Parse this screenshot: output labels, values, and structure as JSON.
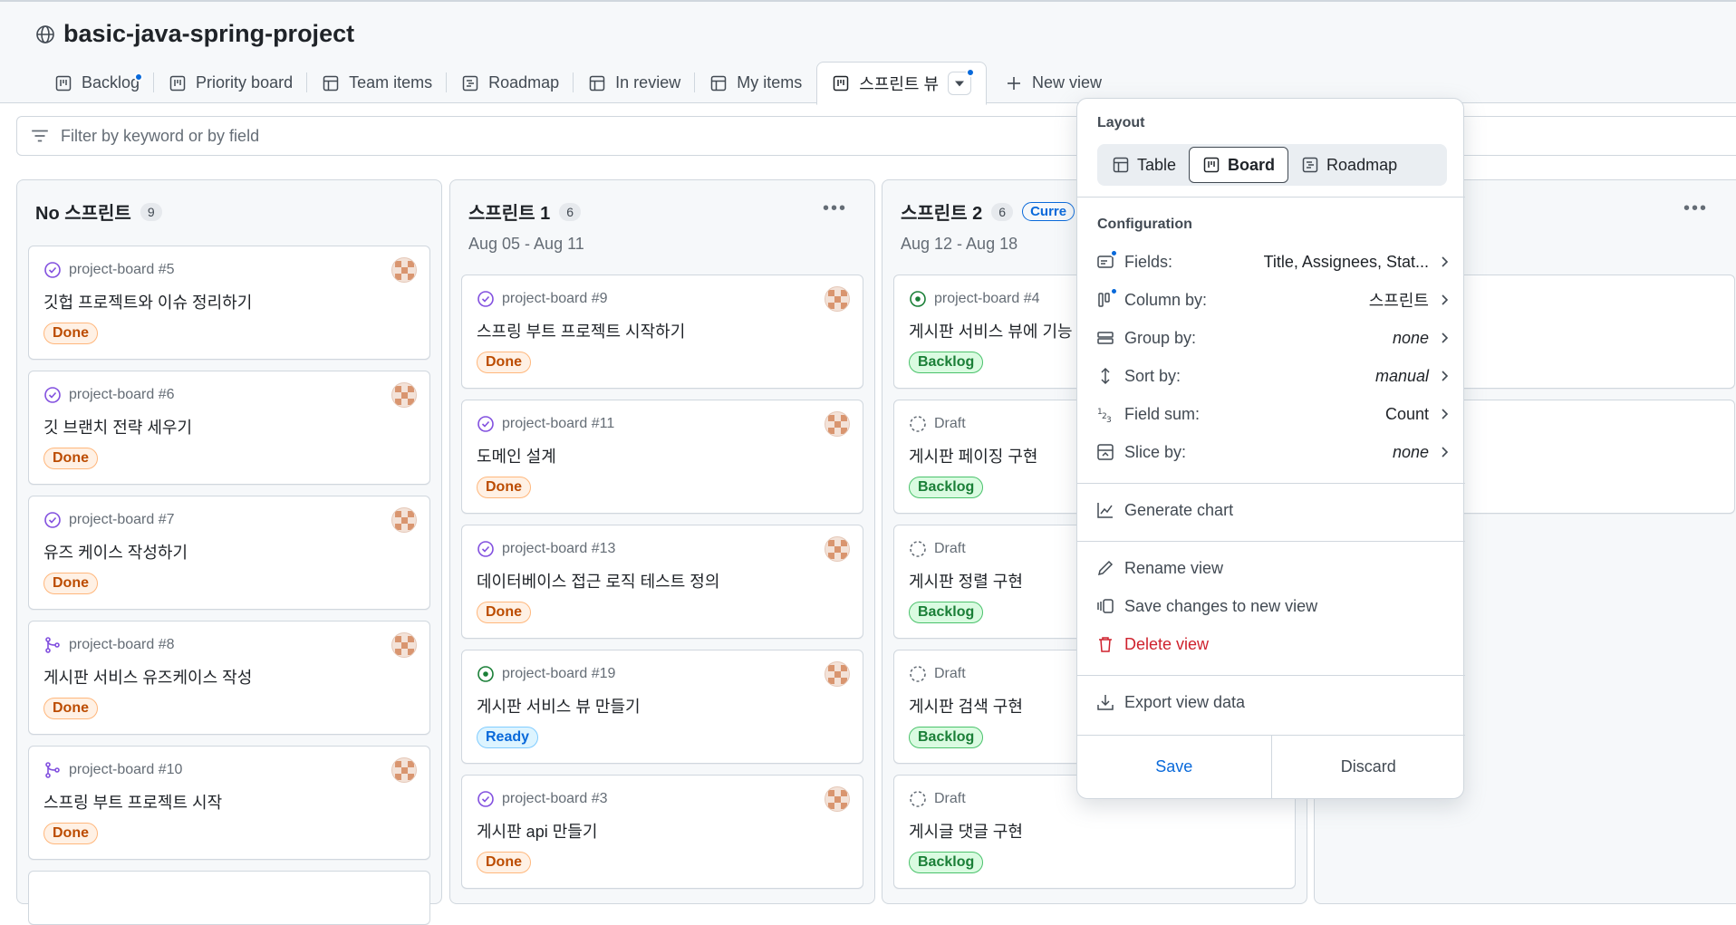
{
  "project": {
    "title": "basic-java-spring-project"
  },
  "tabs": [
    {
      "label": "Backlog",
      "icon": "board-icon"
    },
    {
      "label": "Priority board",
      "icon": "board-icon"
    },
    {
      "label": "Team items",
      "icon": "table-icon"
    },
    {
      "label": "Roadmap",
      "icon": "roadmap-icon"
    },
    {
      "label": "In review",
      "icon": "table-icon"
    },
    {
      "label": "My items",
      "icon": "table-icon"
    },
    {
      "label": "스프린트 뷰",
      "icon": "board-icon"
    }
  ],
  "new_view_label": "New view",
  "filter": {
    "placeholder": "Filter by keyword or by field"
  },
  "columns": [
    {
      "title": "No 스프린트",
      "count": "9",
      "dates": "",
      "cards": [
        {
          "ref": "project-board #5",
          "title": "깃헙 프로젝트와 이슈 정리하기",
          "status": "Done"
        },
        {
          "ref": "project-board #6",
          "title": "깃 브랜치 전략 세우기",
          "status": "Done"
        },
        {
          "ref": "project-board #7",
          "title": "유즈 케이스 작성하기",
          "status": "Done"
        },
        {
          "ref": "project-board #8",
          "title": "게시판 서비스 유즈케이스 작성",
          "status": "Done"
        },
        {
          "ref": "project-board #10",
          "title": "스프링 부트 프로젝트 시작",
          "status": "Done"
        }
      ]
    },
    {
      "title": "스프린트 1",
      "count": "6",
      "dates": "Aug 05 - Aug 11",
      "cards": [
        {
          "ref": "project-board #9",
          "title": "스프링 부트 프로젝트 시작하기",
          "status": "Done"
        },
        {
          "ref": "project-board #11",
          "title": "도메인 설계",
          "status": "Done"
        },
        {
          "ref": "project-board #13",
          "title": "데이터베이스 접근 로직 테스트 정의",
          "status": "Done"
        },
        {
          "ref": "project-board #19",
          "title": "게시판 서비스 뷰 만들기",
          "status": "Ready"
        },
        {
          "ref": "project-board #3",
          "title": "게시판 api 만들기",
          "status": "Done"
        }
      ]
    },
    {
      "title": "스프린트 2",
      "count": "6",
      "dates": "Aug 12 - Aug 18",
      "badge": "Curre",
      "cards": [
        {
          "ref": "project-board #4",
          "title": "게시판 서비스 뷰에 기능 구",
          "status": "Backlog"
        },
        {
          "ref": "Draft",
          "title": "게시판 페이징 구현",
          "status": "Backlog"
        },
        {
          "ref": "Draft",
          "title": "게시판 정렬 구현",
          "status": "Backlog"
        },
        {
          "ref": "Draft",
          "title": "게시판 검색 구현",
          "status": "Backlog"
        },
        {
          "ref": "Draft",
          "title": "게시글 댓글 구현",
          "status": "Backlog"
        }
      ]
    }
  ],
  "menu": {
    "layout_label": "Layout",
    "layouts": [
      "Table",
      "Board",
      "Roadmap"
    ],
    "config_label": "Configuration",
    "config": [
      {
        "label": "Fields:",
        "value": "Title, Assignees, Stat..."
      },
      {
        "label": "Column by:",
        "value": "스프린트"
      },
      {
        "label": "Group by:",
        "value": "none"
      },
      {
        "label": "Sort by:",
        "value": "manual"
      },
      {
        "label": "Field sum:",
        "value": "Count"
      },
      {
        "label": "Slice by:",
        "value": "none"
      }
    ],
    "generate_chart": "Generate chart",
    "rename": "Rename view",
    "save_new": "Save changes to new view",
    "delete": "Delete view",
    "export": "Export view data",
    "save": "Save",
    "discard": "Discard"
  },
  "colors": {
    "accent": "#0969da",
    "done": "#bc4c00",
    "backlog": "#1a7f37",
    "danger": "#cf222e"
  }
}
